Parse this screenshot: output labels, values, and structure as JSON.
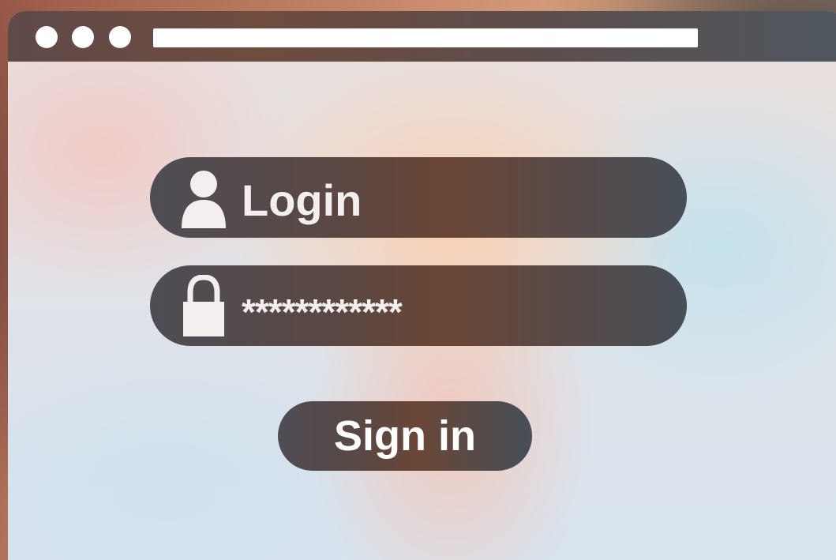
{
  "window": {
    "title_text": "",
    "controls": [
      "window-dot",
      "window-dot",
      "window-dot"
    ]
  },
  "form": {
    "login": {
      "value": "Login",
      "icon": "user-icon"
    },
    "password": {
      "value": "************",
      "icon": "lock-icon"
    },
    "sign_in_label": "Sign in"
  },
  "colors": {
    "field_background": "#5a4a47",
    "text": "#ffffff"
  }
}
